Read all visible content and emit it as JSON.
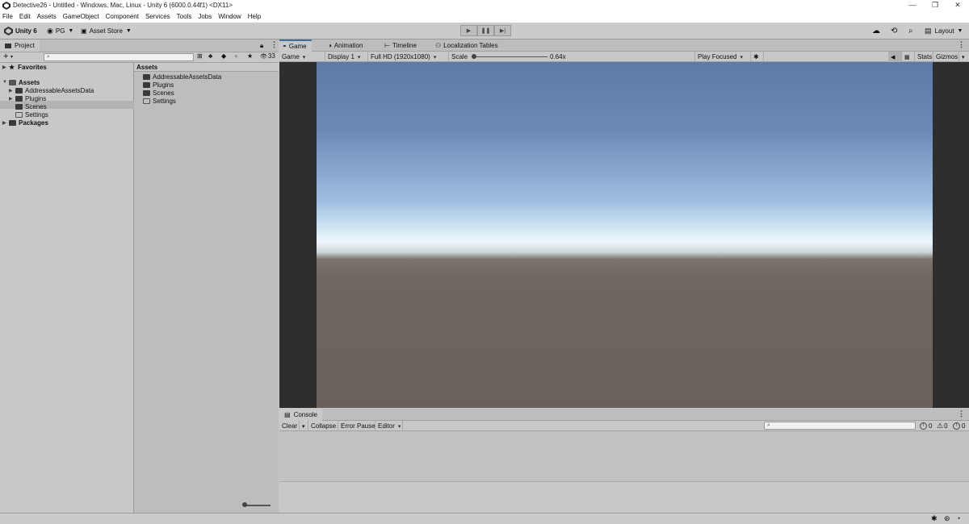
{
  "window": {
    "title": "Detective26 - Untitled - Windows, Mac, Linux - Unity 6 (6000.0.44f1) <DX11>",
    "controls": [
      "—",
      "❐",
      "✕"
    ]
  },
  "menu": [
    "File",
    "Edit",
    "Assets",
    "GameObject",
    "Component",
    "Services",
    "Tools",
    "Jobs",
    "Window",
    "Help"
  ],
  "toolbar": {
    "unity_label": "Unity 6",
    "account_label": "PG",
    "asset_store_label": "Asset Store",
    "layout_label": "Layout",
    "play_icons": [
      "▶",
      "❚❚",
      "▶|"
    ]
  },
  "project": {
    "tab_label": "Project",
    "search_placeholder": "",
    "hidden_count": "33",
    "tree": {
      "favorites": "Favorites",
      "assets": "Assets",
      "children": [
        "AddressableAssetsData",
        "Plugins",
        "Scenes",
        "Settings"
      ],
      "packages": "Packages"
    },
    "grid": {
      "header": "Assets",
      "items": [
        "AddressableAssetsData",
        "Plugins",
        "Scenes",
        "Settings"
      ]
    }
  },
  "game_view": {
    "tabs": [
      "Game",
      "Animation",
      "Timeline",
      "Localization Tables"
    ],
    "bar": {
      "mode": "Game",
      "display": "Display 1",
      "resolution": "Full HD (1920x1080)",
      "scale_label": "Scale",
      "scale_value": "0.64x",
      "scale_fraction": 0.0,
      "play_mode": "Play Focused",
      "stats_label": "Stats",
      "gizmos_label": "Gizmos"
    }
  },
  "console": {
    "tab_label": "Console",
    "clear_label": "Clear",
    "collapse_label": "Collapse",
    "error_pause_label": "Error Pause",
    "editor_label": "Editor",
    "info_count": "0",
    "warn_count": "0",
    "error_count": "0"
  }
}
